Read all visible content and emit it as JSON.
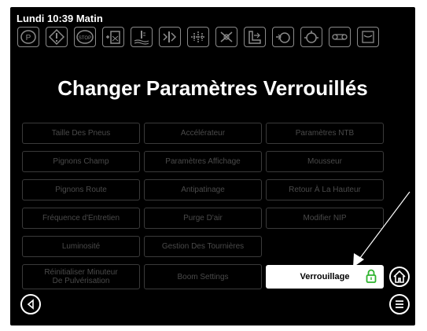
{
  "status": {
    "datetime": "Lundi 10:39 Matin"
  },
  "warning_icons": [
    "parking-brake-icon",
    "warning-diamond-icon",
    "stop-icon",
    "fuel-tank-icon",
    "coolant-temp-icon",
    "transmission-icon",
    "axle-icon",
    "no-ground-icon",
    "boom-icon",
    "hydraulic-icon",
    "oil-pressure-icon",
    "belt-icon",
    "filter-icon"
  ],
  "title": "Changer Paramètres Verrouillés",
  "buttons": {
    "taille": "Taille Des Pneus",
    "accelerateur": "Accélérateur",
    "ntb": "Paramètres NTB",
    "pignons_champ": "Pignons Champ",
    "affichage": "Paramètres Affichage",
    "mousseur": "Mousseur",
    "pignons_route": "Pignons Route",
    "antipatinage": "Antipatinage",
    "retour": "Retour À La Hauteur",
    "entretien": "Fréquence d'Entretien",
    "purge": "Purge D'air",
    "nip": "Modifier NIP",
    "luminosite": "Luminosité",
    "tournieres": "Gestion Des Tournières",
    "reinit_line1": "Réinitialiser Minuteur",
    "reinit_line2": "De Pulvérisation",
    "boom": "Boom Settings",
    "verrouillage": "Verrouillage"
  },
  "colors": {
    "lock_icon": "#2db32d",
    "disabled_text": "#4a4a4a",
    "disabled_border": "#3a3a3a"
  }
}
